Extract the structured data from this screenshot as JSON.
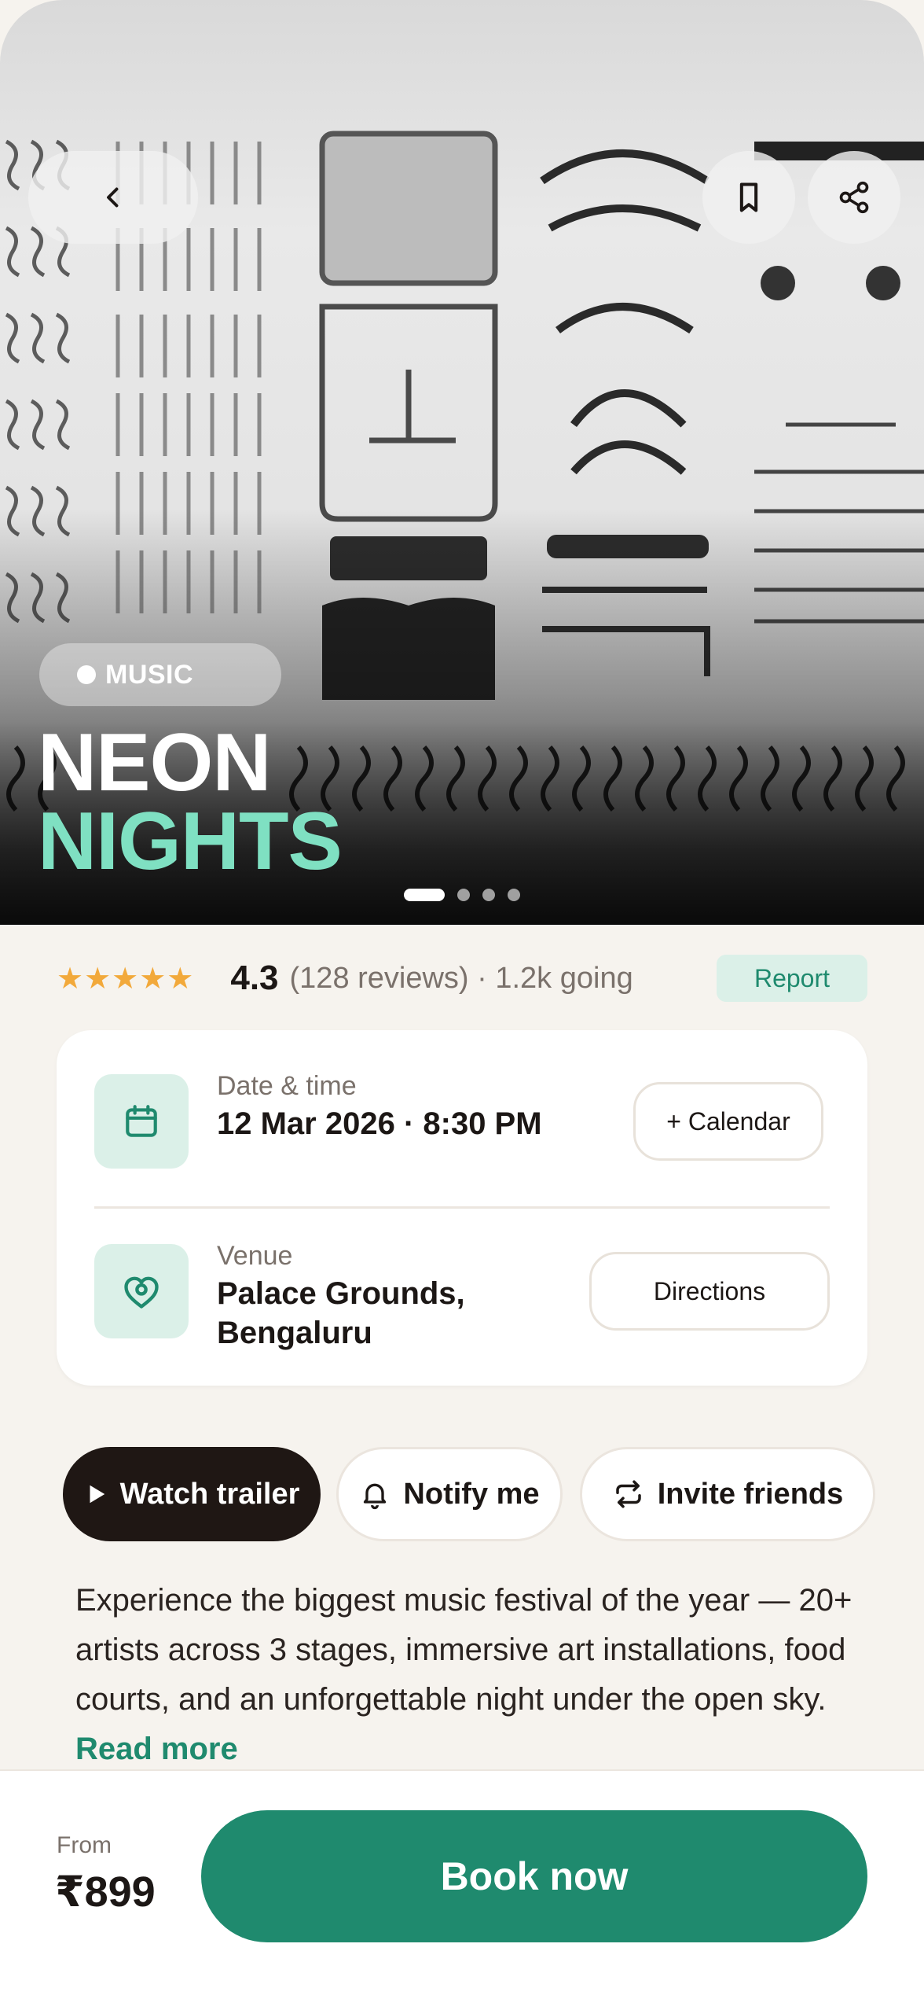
{
  "hero": {
    "category_tag": "MUSIC",
    "title_line1": "NEON",
    "title_line2": "NIGHTS",
    "pager": {
      "pages": 4,
      "active_index": 0
    }
  },
  "header_actions": {
    "back_icon": "chevron-left-icon",
    "bookmark_icon": "bookmark-icon",
    "share_icon": "share-icon"
  },
  "rating": {
    "stars_display": "★★★★★",
    "value": "4.3",
    "meta": "(128 reviews) · 1.2k going",
    "report_label": "Report"
  },
  "details": {
    "date_label": "Date & time",
    "date_value": "12 Mar 2026 · 8:30 PM",
    "calendar_button": "+ Calendar",
    "venue_label": "Venue",
    "venue_value": "Palace Grounds, Bengaluru",
    "directions_button": "Directions"
  },
  "actions": {
    "watch_trailer": "Watch trailer",
    "notify_me": "Notify me",
    "invite_friends": "Invite friends"
  },
  "description": {
    "text": "Experience the biggest music festival of the year — 20+ artists across 3 stages, immersive art installations, food courts, and an unforgettable night under the open sky.",
    "read_more": "Read more"
  },
  "booking": {
    "from_label": "From",
    "price": "₹899",
    "book_button": "Book now"
  },
  "colors": {
    "accent": "#1f8a6e",
    "accent_light": "#dbf0e8",
    "title_highlight": "#7fe0c2",
    "star": "#f2a93b",
    "background": "#f6f3ee",
    "dark_chip": "#1f1714"
  }
}
